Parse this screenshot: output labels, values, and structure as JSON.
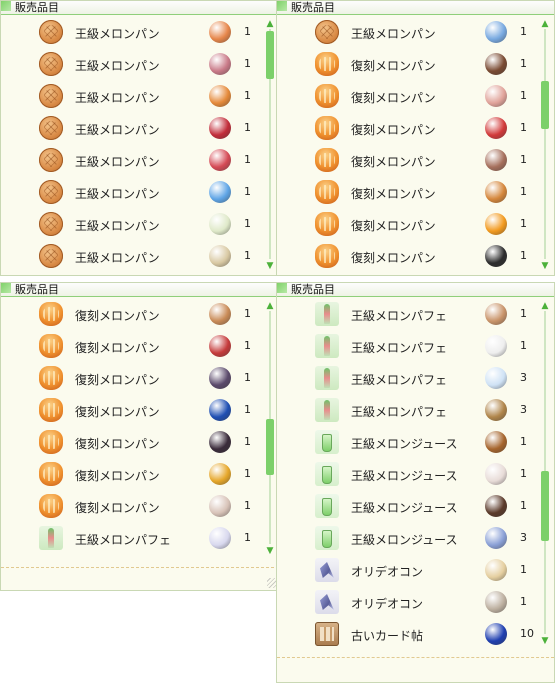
{
  "panels": [
    {
      "title": "販売品目",
      "rows": [
        {
          "item": "王級メロンパン",
          "icon": "melon-bread-icon",
          "resource_icon": "sweet-potato-icon",
          "color": "#e6864a",
          "qty": "1"
        },
        {
          "item": "王級メロンパン",
          "icon": "melon-bread-icon",
          "resource_icon": "pink-seed-icon",
          "color": "#c97a88",
          "qty": "1"
        },
        {
          "item": "王級メロンパン",
          "icon": "melon-bread-icon",
          "resource_icon": "carrot-icon",
          "color": "#e58a3a",
          "qty": "1"
        },
        {
          "item": "王級メロンパン",
          "icon": "melon-bread-icon",
          "resource_icon": "red-star-icon",
          "color": "#c22d3a",
          "qty": "1"
        },
        {
          "item": "王級メロンパン",
          "icon": "melon-bread-icon",
          "resource_icon": "red-gem-icon",
          "color": "#d54a55",
          "qty": "1"
        },
        {
          "item": "王級メロンパン",
          "icon": "melon-bread-icon",
          "resource_icon": "blue-wings-icon",
          "color": "#5fa5e6",
          "qty": "1"
        },
        {
          "item": "王級メロンパン",
          "icon": "melon-bread-icon",
          "resource_icon": "white-flower-icon",
          "color": "#dfe9c9",
          "qty": "1"
        },
        {
          "item": "王級メロンパン",
          "icon": "melon-bread-icon",
          "resource_icon": "tooth-icon",
          "color": "#d9c9a3",
          "qty": "1"
        }
      ]
    },
    {
      "title": "販売品目",
      "rows": [
        {
          "item": "王級メロンパン",
          "icon": "melon-bread-icon",
          "resource_icon": "blue-jelly-icon",
          "color": "#78a9e0",
          "qty": "1"
        },
        {
          "item": "復刻メロンパン",
          "icon": "revival-melon-bread-icon",
          "resource_icon": "brown-bug-icon",
          "color": "#7a4b33",
          "qty": "1"
        },
        {
          "item": "復刻メロンパン",
          "icon": "revival-melon-bread-icon",
          "resource_icon": "pink-shell-icon",
          "color": "#e0a39a",
          "qty": "1"
        },
        {
          "item": "復刻メロンパン",
          "icon": "revival-melon-bread-icon",
          "resource_icon": "red-flower-icon",
          "color": "#d23b3b",
          "qty": "1"
        },
        {
          "item": "復刻メロンパン",
          "icon": "revival-melon-bread-icon",
          "resource_icon": "brown-shell-icon",
          "color": "#a6705d",
          "qty": "1"
        },
        {
          "item": "復刻メロンパン",
          "icon": "revival-melon-bread-icon",
          "resource_icon": "orange-feather-icon",
          "color": "#d5873c",
          "qty": "1"
        },
        {
          "item": "復刻メロンパン",
          "icon": "revival-melon-bread-icon",
          "resource_icon": "fire-orb-icon",
          "color": "#f29a1f",
          "qty": "1"
        },
        {
          "item": "復刻メロンパン",
          "icon": "revival-melon-bread-icon",
          "resource_icon": "black-stone-icon",
          "color": "#2d2d2d",
          "qty": "1"
        }
      ]
    },
    {
      "title": "販売品目",
      "rows": [
        {
          "item": "復刻メロンパン",
          "icon": "revival-melon-bread-icon",
          "resource_icon": "tan-bread-icon",
          "color": "#c98b57",
          "qty": "1"
        },
        {
          "item": "復刻メロンパン",
          "icon": "revival-melon-bread-icon",
          "resource_icon": "red-flower-icon",
          "color": "#c53b3b",
          "qty": "1"
        },
        {
          "item": "復刻メロンパン",
          "icon": "revival-melon-bread-icon",
          "resource_icon": "bat-wing-icon",
          "color": "#5b4a6b",
          "qty": "1"
        },
        {
          "item": "復刻メロンパン",
          "icon": "revival-melon-bread-icon",
          "resource_icon": "blue-orb-icon",
          "color": "#1f4fb3",
          "qty": "1"
        },
        {
          "item": "復刻メロンパン",
          "icon": "revival-melon-bread-icon",
          "resource_icon": "black-cat-icon",
          "color": "#3a2b3a",
          "qty": "1"
        },
        {
          "item": "復刻メロンパン",
          "icon": "revival-melon-bread-icon",
          "resource_icon": "gold-card-icon",
          "color": "#e6a72a",
          "qty": "1"
        },
        {
          "item": "復刻メロンパン",
          "icon": "revival-melon-bread-icon",
          "resource_icon": "skull-doll-icon",
          "color": "#d8c3b8",
          "qty": "1"
        },
        {
          "item": "王級メロンパフェ",
          "icon": "melon-parfait-icon",
          "resource_icon": "white-wing-icon",
          "color": "#d8d8ee",
          "qty": "1"
        }
      ]
    },
    {
      "title": "販売品目",
      "rows": [
        {
          "item": "王級メロンパフェ",
          "icon": "melon-parfait-icon",
          "resource_icon": "mushroom-icon",
          "color": "#c9946a",
          "qty": "1"
        },
        {
          "item": "王級メロンパフェ",
          "icon": "melon-parfait-icon",
          "resource_icon": "white-fur-icon",
          "color": "#eeeeee",
          "qty": "1"
        },
        {
          "item": "王級メロンパフェ",
          "icon": "melon-parfait-icon",
          "resource_icon": "cloud-icon",
          "color": "#cfe2f5",
          "qty": "3"
        },
        {
          "item": "王級メロンパフェ",
          "icon": "melon-parfait-icon",
          "resource_icon": "poop-icon",
          "color": "#b0854a",
          "qty": "3"
        },
        {
          "item": "王級メロンジュース",
          "icon": "melon-juice-icon",
          "resource_icon": "key-icon",
          "color": "#a6652d",
          "qty": "1"
        },
        {
          "item": "王級メロンジュース",
          "icon": "melon-juice-icon",
          "resource_icon": "pearl-icon",
          "color": "#e8dcd8",
          "qty": "1"
        },
        {
          "item": "王級メロンジュース",
          "icon": "melon-juice-icon",
          "resource_icon": "claw-icon",
          "color": "#5b3a2a",
          "qty": "1"
        },
        {
          "item": "王級メロンジュース",
          "icon": "melon-juice-icon",
          "resource_icon": "blue-gem-icon",
          "color": "#8aa0d6",
          "qty": "3"
        },
        {
          "item": "オリデオコン",
          "icon": "oridecon-icon",
          "resource_icon": "cream-bun-icon",
          "color": "#e5cfa0",
          "qty": "1"
        },
        {
          "item": "オリデオコン",
          "icon": "oridecon-icon",
          "resource_icon": "spotted-egg-icon",
          "color": "#bdb0a0",
          "qty": "1"
        },
        {
          "item": "古いカード帖",
          "icon": "old-card-album-icon",
          "resource_icon": "blue-crystal-icon",
          "color": "#1f3fb0",
          "qty": "10"
        }
      ]
    }
  ]
}
